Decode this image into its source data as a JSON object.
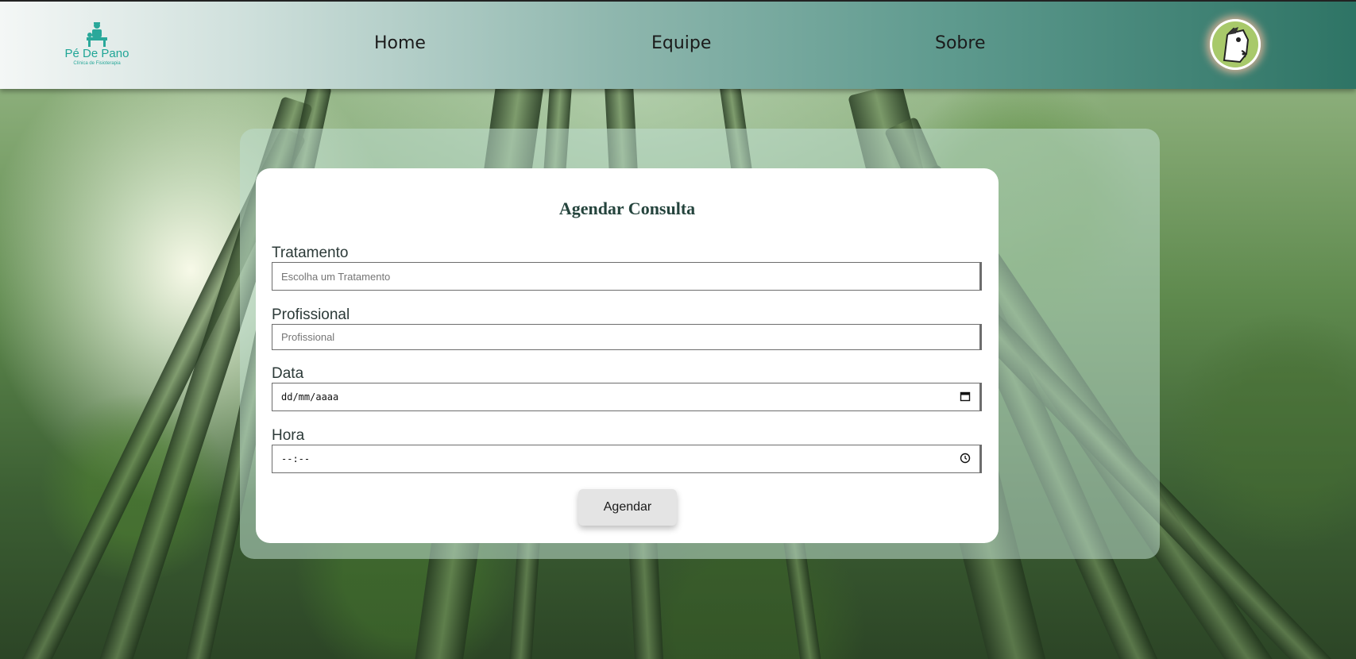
{
  "header": {
    "logo": {
      "name": "Pé De Pano",
      "subtitle": "Clínica de Fisioterapia"
    },
    "nav": {
      "home": "Home",
      "equipe": "Equipe",
      "sobre": "Sobre"
    }
  },
  "form": {
    "title": "Agendar Consulta",
    "tratamento": {
      "label": "Tratamento",
      "placeholder": "Escolha um Tratamento"
    },
    "profissional": {
      "label": "Profissional",
      "placeholder": "Profissional"
    },
    "data": {
      "label": "Data",
      "value": "dd/mm/aaaa"
    },
    "hora": {
      "label": "Hora",
      "value": "--:--"
    },
    "submit_label": "Agendar"
  },
  "colors": {
    "brand_teal": "#2aa89a",
    "header_dark": "#2e7465",
    "title_text": "#25443d"
  },
  "icons": {
    "date": "calendar-icon",
    "time": "clock-icon",
    "avatar": "horse-mascot-icon"
  }
}
